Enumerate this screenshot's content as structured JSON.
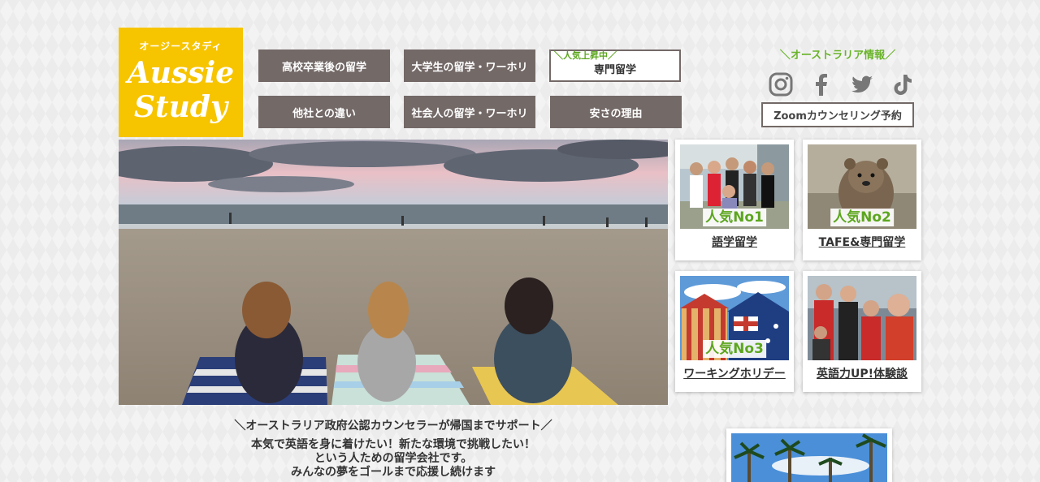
{
  "logo": {
    "kana": "オージースタディ",
    "word1": "Aussie",
    "word2": "Study"
  },
  "nav": {
    "row1": [
      {
        "label": "高校卒業後の留学"
      },
      {
        "label": "大学生の留学・ワーホリ"
      },
      {
        "tag": "＼人気上昇中／",
        "label": "専門留学"
      }
    ],
    "row2": [
      {
        "label": "他社との違い"
      },
      {
        "label": "社会人の留学・ワーホリ"
      },
      {
        "label": "安さの理由"
      }
    ]
  },
  "header_right": {
    "au_info": "＼オーストラリア情報／",
    "social_icons": [
      "instagram-icon",
      "facebook-icon",
      "twitter-icon",
      "tiktok-icon"
    ],
    "zoom_button": "Zoomカウンセリング予約"
  },
  "cards": [
    {
      "rank": "人気No1",
      "title": "語学留学"
    },
    {
      "rank": "人気No2",
      "title": "TAFE&専門留学"
    },
    {
      "rank": "人気No3",
      "title": "ワーキングホリデー"
    },
    {
      "rank": "",
      "title": "英語力UP!体験談"
    }
  ],
  "tagline": "＼オーストラリア政府公認カウンセラーが帰国までサポート／",
  "intro": {
    "line1": "本気で英語を身に着けたい！新たな環境で挑戦したい！",
    "line2": "という人ための留学会社です。",
    "line3": "みんなの夢をゴールまで応援し続けます"
  },
  "colors": {
    "accent_yellow": "#f7c400",
    "nav_gray": "#736967",
    "accent_green": "#5ca61e"
  }
}
